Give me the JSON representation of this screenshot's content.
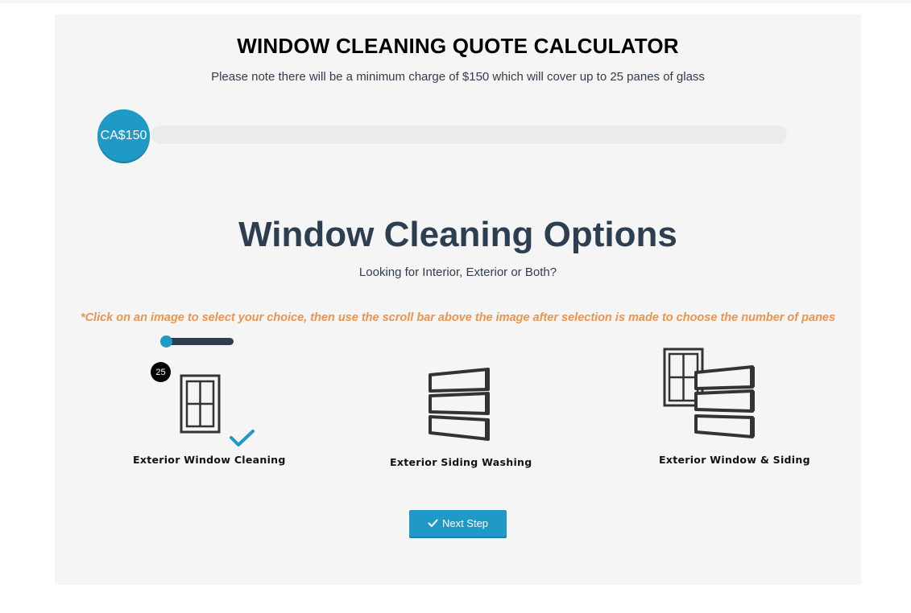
{
  "calculator": {
    "title": "WINDOW CLEANING QUOTE CALCULATOR",
    "note": "Please note there will be a minimum charge of $150 which will cover up to 25 panes of glass",
    "price_label": "CA$150",
    "price_progress_fraction": 0
  },
  "options_section": {
    "title": "Window Cleaning Options",
    "subtitle": "Looking for Interior, Exterior or Both?",
    "instruction": "*Click on an image to select your choice, then use the scroll bar above the image after selection is made to choose the number of panes"
  },
  "pane_slider": {
    "value": "25"
  },
  "options": [
    {
      "label": "Exterior Window Cleaning",
      "icon": "window-icon",
      "selected": true
    },
    {
      "label": "Exterior Siding Washing",
      "icon": "siding-icon",
      "selected": false
    },
    {
      "label": "Exterior Window & Siding",
      "icon": "window-siding-icon",
      "selected": false
    }
  ],
  "next_button": {
    "label": "Next Step",
    "icon": "check-icon"
  },
  "colors": {
    "accent": "#1f9ac6",
    "heading": "#2c3e50",
    "instruction": "#e8954f",
    "panel_bg": "#f5f5f5"
  }
}
